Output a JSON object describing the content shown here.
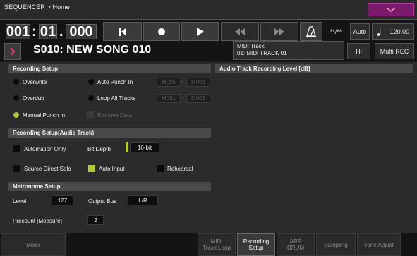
{
  "title": "SEQUENCER > Home",
  "transport": {
    "measure": "001",
    "beat": "01",
    "tick": "000",
    "meter": "**/**",
    "tempo_mode": "Auto",
    "tempo": "120.00"
  },
  "song": {
    "name": "S010: NEW SONG 010",
    "track_type": "MIDI Track",
    "track_name": "01: MIDI TRACK 01",
    "resolution": "Hi",
    "rec_mode": "Multi REC"
  },
  "recording_setup": {
    "header": "Recording Setup",
    "overwrite": "Overwrite",
    "overdub": "Overdub",
    "manual_punch": "Manual Punch In",
    "auto_punch": "Auto Punch In",
    "auto_punch_start": "M005",
    "auto_punch_end": "M008",
    "loop_all": "Loop All Tracks",
    "loop_start": "M001",
    "loop_end": "M001",
    "remove_data": "Remove Data",
    "dash": "-"
  },
  "audio_level": {
    "header": "Audio Track Recording Level [dB]"
  },
  "audio_setup": {
    "header": "Recording Setup(Audio Track)",
    "automation_only": "Automation Only",
    "bit_depth_label": "Bit Depth",
    "bit_depth": "16-bit",
    "source_direct_solo": "Source Direct Solo",
    "auto_input": "Auto Input",
    "rehearsal": "Rehearsal"
  },
  "metronome": {
    "header": "Metronome Setup",
    "level_label": "Level",
    "level": "127",
    "output_bus_label": "Output Bus",
    "output_bus": "L/R",
    "precount_label": "Precount [Measure]",
    "precount": "2"
  },
  "tabs": [
    {
      "label": "Mixer"
    },
    {
      "label": "MIDI\nTrack Loop"
    },
    {
      "label": "Recording\nSetup"
    },
    {
      "label": "ARP\nDRUM"
    },
    {
      "label": "Sampling"
    },
    {
      "label": "Tone Adjust"
    }
  ],
  "colors": {
    "accent": "#b5c73a",
    "arrow": "#e0457a",
    "collapse": "#7a1a6a"
  },
  "icons": {
    "collapse": "chevron-down-icon",
    "locate": "locate-start-icon",
    "record": "record-icon",
    "play": "play-icon",
    "rewind": "rewind-icon",
    "forward": "fast-forward-icon",
    "metronome": "metronome-icon",
    "note": "quarter-note-icon",
    "song_menu": "chevron-right-icon"
  }
}
